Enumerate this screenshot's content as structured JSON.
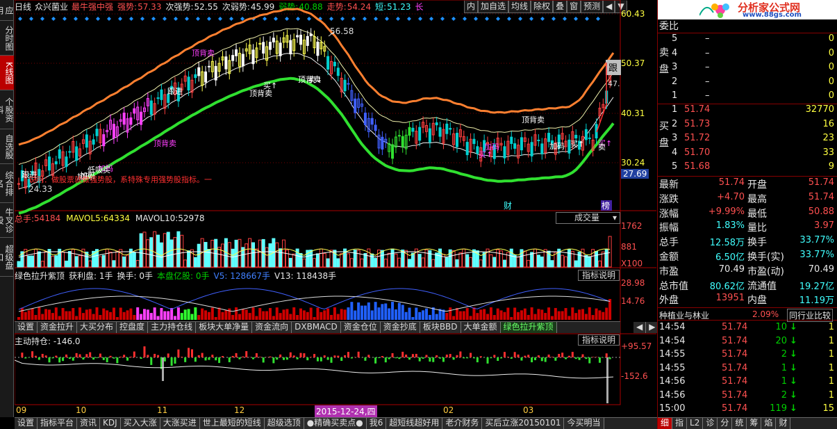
{
  "top": {
    "period": "日线",
    "stock": "众兴菌业",
    "items": [
      {
        "label": "最牛强中强",
        "color": "#ff5050"
      },
      {
        "label": "强势:",
        "color": "#ff5050"
      },
      {
        "label": "57.33",
        "color": "#ff5050"
      },
      {
        "label": "次强势:",
        "color": "#e8e8e8"
      },
      {
        "label": "52.55",
        "color": "#e8e8e8"
      },
      {
        "label": "次弱势:",
        "color": "#e8e8e8"
      },
      {
        "label": "45.99",
        "color": "#e8e8e8"
      },
      {
        "label": "弱势:",
        "color": "#00d000"
      },
      {
        "label": "40.88",
        "color": "#00d000"
      },
      {
        "label": "走势:",
        "color": "#ff5050"
      },
      {
        "label": "54.24",
        "color": "#ff5050"
      },
      {
        "label": "短:",
        "color": "#40ffff"
      },
      {
        "label": "51.23",
        "color": "#40ffff"
      },
      {
        "label": "长",
        "color": "#ff40ff"
      }
    ]
  },
  "toolbar": [
    "内",
    "加自选",
    "均线",
    "除权",
    "叠",
    "窗",
    "预测",
    "◀",
    "▼"
  ],
  "left_buttons": [
    "应用",
    "分时图",
    "K线图",
    "个股资料",
    "自选股",
    "综合排名",
    "牛叉诊股",
    "超级盘口"
  ],
  "left_active": 2,
  "price_axis": [
    "60.43",
    "50.37",
    "40.31",
    "30.24",
    "27.69"
  ],
  "price_labels": {
    "high": "56.58",
    "low": "24.33",
    "last_tag": "跟",
    "last_val": "47."
  },
  "chart_annotations": [
    "跟进",
    "顶背卖",
    "顶背卖",
    "买↑",
    "顶背卖",
    "卖↓",
    "顶背卖",
    "买↑",
    "跟进",
    "加码",
    "加码",
    "加码",
    "顶背卖",
    "加码",
    "买↑",
    "加码",
    "买↑",
    "低吸买",
    "卖"
  ],
  "chart_notice": "说明：做股票就做强势股，系特殊专用强势股指标。一",
  "markers": [
    "财",
    "榜"
  ],
  "vol": {
    "label": "总手:",
    "value": "54184",
    "ma5_label": "MAVOL5:",
    "ma5": "64334",
    "ma10_label": "MAVOL10:",
    "ma10": "52978",
    "dropdown": "成交量",
    "axis": [
      "1762",
      "881",
      "X100"
    ]
  },
  "ind1": {
    "name": "绿色拉升紫顶",
    "fields": [
      {
        "t": "获利盘: 1手",
        "c": "#e8e8e8"
      },
      {
        "t": "换手: 0手",
        "c": "#e8e8e8"
      },
      {
        "t": "本盘亿股: 0手",
        "c": "#00d000"
      },
      {
        "t": "V5: 128667手",
        "c": "#4080ff"
      },
      {
        "t": "V13: 118438手",
        "c": "#e8e8e8"
      }
    ],
    "btn": "指标说明",
    "axis": [
      "28.98",
      "14.76"
    ]
  },
  "tabs1": [
    "设置",
    "资金拉升",
    "大买分布",
    "控盘度",
    "主力持仓线",
    "板块大单净量",
    "资金流向",
    "DXBMACD",
    "资金仓位",
    "资金抄底",
    "板块BBD",
    "大单金额",
    "绿色拉升紫顶"
  ],
  "tabs1_active": 12,
  "ind2": {
    "name": "主动持仓: -146.0",
    "btn": "指标说明",
    "axis": [
      "+95.57",
      "-152.6"
    ]
  },
  "dates": [
    "09",
    "10",
    "11",
    "12",
    "2015-12-24,四",
    "02",
    "03"
  ],
  "tabs2": [
    "设置",
    "指标平台",
    "资讯",
    "KDJ",
    "买入大涨",
    "大涨买进",
    "世上最短的短线",
    "超级选顶",
    "●精确买卖点●",
    "我6",
    "超短线超好用",
    "老介财务",
    "买后立涨20150101",
    "今买明当"
  ],
  "right": {
    "logo_text": "分析家公式网",
    "logo_url": "www.88gs.com",
    "weibi": "委比",
    "sell_label": "卖盘",
    "buy_label": "买盘",
    "sell": [
      [
        "5",
        "–",
        "0"
      ],
      [
        "4",
        "–",
        "0"
      ],
      [
        "3",
        "–",
        "0"
      ],
      [
        "2",
        "–",
        "0"
      ],
      [
        "1",
        "–",
        "0"
      ]
    ],
    "buy": [
      [
        "1",
        "51.74",
        "32770"
      ],
      [
        "2",
        "51.73",
        "16"
      ],
      [
        "3",
        "51.72",
        "23"
      ],
      [
        "4",
        "51.70",
        "33"
      ],
      [
        "5",
        "51.68",
        "9"
      ]
    ],
    "stats": [
      [
        {
          "k": "最新",
          "v": "51.74",
          "c": "#ff5050"
        },
        {
          "k": "开盘",
          "v": "51.74",
          "c": "#ff5050"
        }
      ],
      [
        {
          "k": "涨跌",
          "v": "+4.70",
          "c": "#ff5050"
        },
        {
          "k": "最高",
          "v": "51.74",
          "c": "#ff5050"
        }
      ],
      [
        {
          "k": "涨幅",
          "v": "+9.99%",
          "c": "#ff5050"
        },
        {
          "k": "最低",
          "v": "50.88",
          "c": "#ff5050"
        }
      ],
      [
        {
          "k": "振幅",
          "v": "1.83%",
          "c": "#40ffff"
        },
        {
          "k": "量比",
          "v": "3.97",
          "c": "#ff5050"
        }
      ],
      [
        {
          "k": "总手",
          "v": "12.58万",
          "c": "#40ffff"
        },
        {
          "k": "换手",
          "v": "33.77%",
          "c": "#40ffff"
        }
      ],
      [
        {
          "k": "金额",
          "v": "6.50亿",
          "c": "#40ffff"
        },
        {
          "k": "换手(实)",
          "v": "33.77%",
          "c": "#40ffff"
        }
      ],
      [
        {
          "k": "市盈",
          "v": "70.49",
          "c": "#e8e8e8"
        },
        {
          "k": "市盈(动)",
          "v": "70.49",
          "c": "#e8e8e8"
        }
      ],
      [
        {
          "k": "总市值",
          "v": "80.62亿",
          "c": "#40ffff"
        },
        {
          "k": "流通值",
          "v": "19.27亿",
          "c": "#40ffff"
        }
      ],
      [
        {
          "k": "外盘",
          "v": "13951",
          "c": "#ff5050"
        },
        {
          "k": "内盘",
          "v": "11.19万",
          "c": "#40ffff"
        }
      ]
    ],
    "industry": "种植业与林业",
    "industry_pct": "2.09%",
    "industry_btn": "同行业比较",
    "ticks": [
      [
        "14:54",
        "51.74",
        "10",
        "↓",
        "1"
      ],
      [
        "14:54",
        "51.74",
        "20",
        "↓",
        "1"
      ],
      [
        "14:55",
        "51.74",
        "2",
        "↓",
        "1"
      ],
      [
        "14:55",
        "51.74",
        "1",
        "↓",
        "1"
      ],
      [
        "14:56",
        "51.74",
        "1",
        "↓",
        "1"
      ],
      [
        "14:56",
        "51.74",
        "2",
        "↓",
        "1"
      ],
      [
        "15:00",
        "51.74",
        "119",
        "↓",
        "15"
      ]
    ],
    "bottom_tabs": [
      "细",
      "指",
      "L2",
      "诊",
      "分",
      "统",
      "筹",
      "焰",
      "财"
    ]
  }
}
